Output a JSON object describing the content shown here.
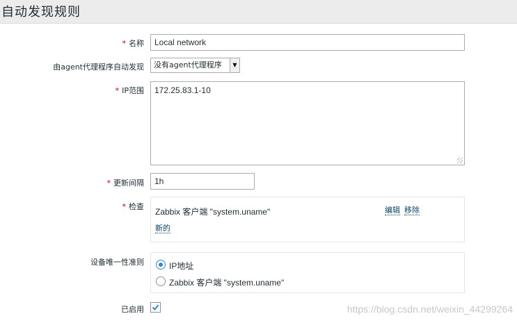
{
  "page": {
    "title": "自动发现规则"
  },
  "form": {
    "name": {
      "required_mark": "*",
      "label": "名称",
      "value": "Local network"
    },
    "proxy": {
      "label": "由agent代理程序自动发现",
      "selected": "没有agent代理程序"
    },
    "ip_range": {
      "required_mark": "*",
      "label": "IP范围",
      "value": "172.25.83.1-10"
    },
    "interval": {
      "required_mark": "*",
      "label": "更新间隔",
      "value": "1h"
    },
    "checks": {
      "required_mark": "*",
      "label": "检查",
      "items": [
        {
          "text": "Zabbix 客户端 \"system.uname\"",
          "edit": "编辑",
          "remove": "移除"
        }
      ],
      "new_link": "新的"
    },
    "uniqueness": {
      "label": "设备唯一性准则",
      "options": [
        {
          "label": "IP地址",
          "checked": true
        },
        {
          "label": "Zabbix 客户端 \"system.uname\"",
          "checked": false
        }
      ]
    },
    "enabled": {
      "label": "已启用",
      "checked": true
    }
  },
  "watermark": "https://blog.csdn.net/weixin_44299264",
  "colors": {
    "accent": "#2c8ad5",
    "link": "#0a466a",
    "required": "#d40000"
  }
}
